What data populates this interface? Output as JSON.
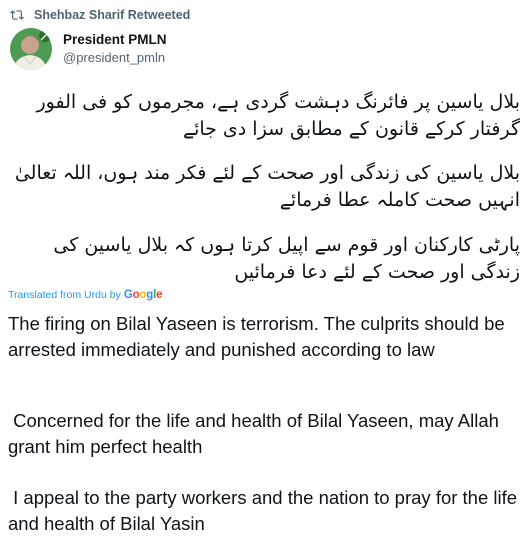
{
  "retweet": {
    "icon": "retweet-icon",
    "label": "Shehbaz Sharif Retweeted"
  },
  "author": {
    "name": "President PMLN",
    "handle": "@president_pmln",
    "avatar": "avatar"
  },
  "tweet": {
    "urdu_paragraphs": [
      "بلال یاسین پر فائرنگ دہشت گردی ہے، مجرموں کو فی الفور گرفتار کرکے قانون کے مطابق سزا دی جائے",
      "بلال یاسین کی زندگی اور صحت کے لئے فکر مند ہوں، اللہ تعالیٰ انہیں صحت کاملہ عطا فرمائے",
      "پارٹی کارکنان اور قوم سے اپیل کرتا ہوں کہ بلال یاسین کی زندگی اور صحت کے لئے دعا فرمائیں"
    ],
    "translated_label": "Translated from Urdu by",
    "translator_brand": "Google",
    "translation_paragraphs": [
      "The firing on Bilal Yaseen is terrorism. The culprits should be arrested immediately and punished according to law",
      " Concerned for the life and health of Bilal Yaseen, may Allah grant him perfect health",
      " I appeal to the party workers and the nation to pray for the life and health of Bilal Yasin"
    ]
  },
  "colors": {
    "text_primary": "#0f1419",
    "text_secondary": "#536471",
    "link_blue": "#1d9bf0"
  }
}
